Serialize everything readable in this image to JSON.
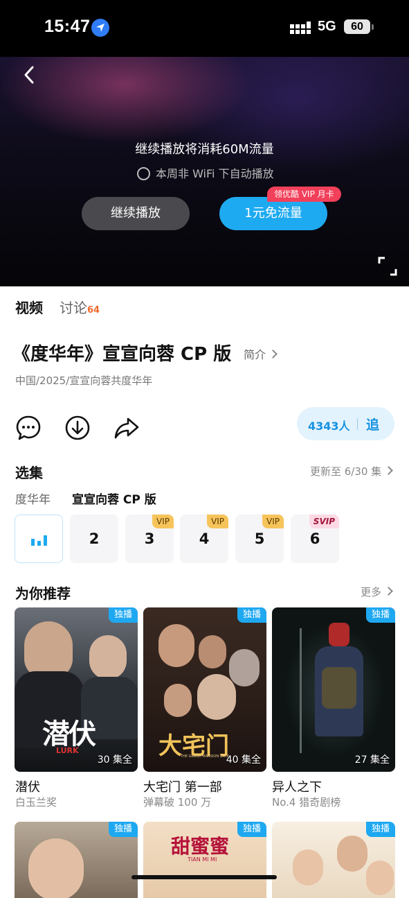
{
  "status_bar": {
    "time": "15:47",
    "network": "5G",
    "battery": "60"
  },
  "player": {
    "message": "继续播放将消耗60M流量",
    "auto_play_label": "本周非 WiFi 下自动播放",
    "continue_label": "继续播放",
    "free_data_label": "1元免流量",
    "vip_card_tag": "领优酷 VIP 月卡"
  },
  "tabs": [
    {
      "label": "视频"
    },
    {
      "label": "讨论",
      "count": "64"
    }
  ],
  "show": {
    "title": "《度华年》宣宣向蓉 CP 版",
    "intro_label": "简介",
    "meta": "中国/2025/宣宣向蓉共度华年"
  },
  "follow": {
    "count": "4343人",
    "label": "追"
  },
  "episodes": {
    "section_title": "选集",
    "update_info": "更新至 6/30 集",
    "seasons": [
      "度华年",
      "宣宣向蓉 CP 版"
    ],
    "items": [
      {
        "number": "",
        "badge": ""
      },
      {
        "number": "2",
        "badge": ""
      },
      {
        "number": "3",
        "badge": "VIP"
      },
      {
        "number": "4",
        "badge": "VIP"
      },
      {
        "number": "5",
        "badge": "VIP"
      },
      {
        "number": "6",
        "badge": "SVIP"
      }
    ]
  },
  "recommend": {
    "section_title": "为你推荐",
    "more_label": "更多",
    "cards": [
      {
        "badge": "独播",
        "episodes": "30 集全",
        "title": "潜伏",
        "subtitle": "白玉兰奖",
        "poster_text": "潜伏",
        "poster_sub": "LURK"
      },
      {
        "badge": "独播",
        "episodes": "40 集全",
        "title": "大宅门 第一部",
        "subtitle": "弹幕破 100 万",
        "poster_text": "大宅门",
        "poster_sub": "THE GRAND MANSION GATE"
      },
      {
        "badge": "独播",
        "episodes": "27 集全",
        "title": "异人之下",
        "subtitle": "No.4 猎奇剧榜"
      }
    ],
    "second_row": [
      {
        "badge": "独播"
      },
      {
        "badge": "独播",
        "poster_text": "甜蜜蜜",
        "poster_sub": "TIAN MI MI"
      },
      {
        "badge": "独播"
      }
    ]
  },
  "colors": {
    "accent": "#1eaaf1",
    "vip_badge": "#f6c45a",
    "tag_red": "#f2405a"
  }
}
